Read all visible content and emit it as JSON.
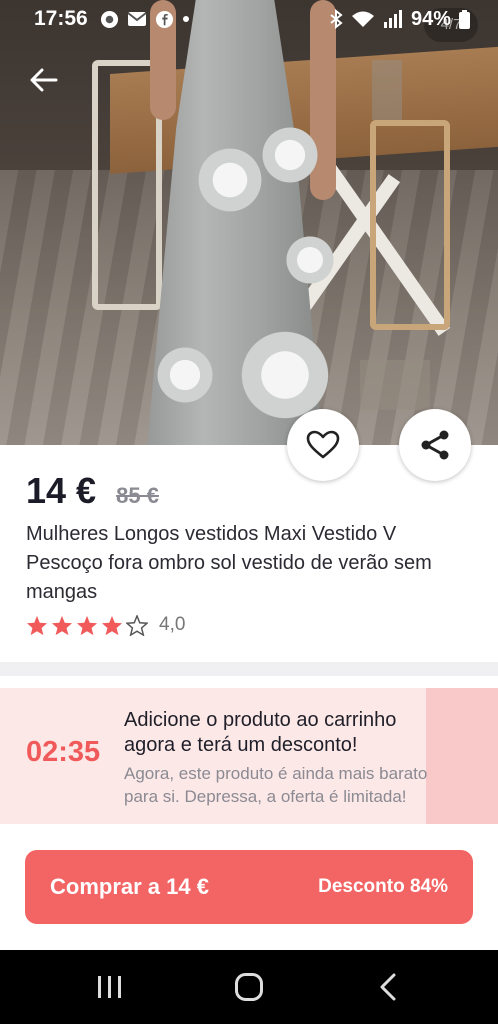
{
  "status_bar": {
    "time": "17:56",
    "battery": "94%",
    "left_icons": [
      "chrome-icon",
      "mail-icon",
      "facebook-icon",
      "dot-icon"
    ],
    "right_icons": [
      "bluetooth-icon",
      "wifi-icon",
      "signal-icon",
      "battery-icon"
    ]
  },
  "gallery": {
    "counter": "4/7"
  },
  "product": {
    "price": "14 €",
    "old_price": "85 €",
    "title": "Mulheres Longos vestidos Maxi Vestido V Pescoço fora ombro sol vestido de verão sem mangas",
    "rating_value": "4,0",
    "stars_filled": 4,
    "stars_total": 5
  },
  "promo": {
    "timer": "02:35",
    "headline": "Adicione o produto ao carrinho agora e terá um desconto!",
    "description": "Agora, este produto é ainda mais barato para si. Depressa, a oferta é limitada!"
  },
  "buy_button": {
    "label": "Comprar a 14 €",
    "discount": "Desconto 84%"
  },
  "colors": {
    "accent": "#f36464",
    "timer": "#f05a5a",
    "banner_bg": "#fde8e8",
    "star": "#f05a5a"
  }
}
